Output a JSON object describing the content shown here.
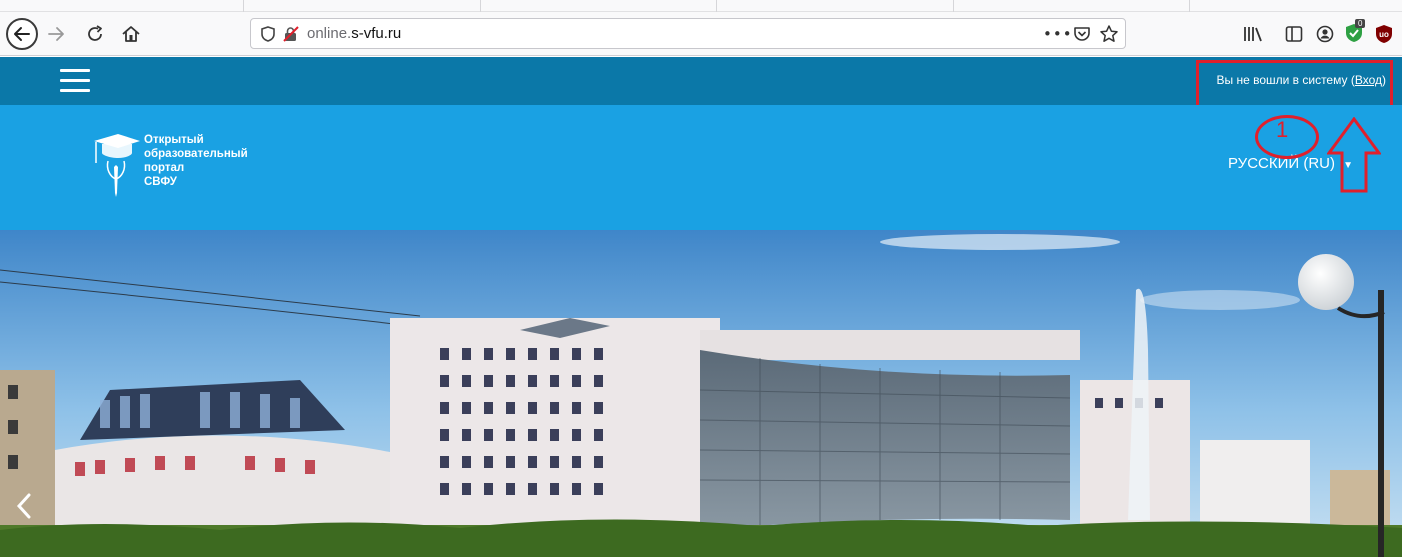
{
  "browser": {
    "url_prefix": "online.",
    "url_domain": "s-vfu.ru",
    "ext_badge": "0"
  },
  "site": {
    "login_text": "Вы не вошли в систему",
    "login_link": "Вход",
    "logo_lines": [
      "Открытый",
      "образовательный",
      "портал",
      "СВФУ"
    ],
    "language": "РУССКИЙ (RU)"
  },
  "annotation": {
    "number": "1"
  },
  "colors": {
    "topbar": "#0b78a8",
    "brand_band": "#1aa1e3",
    "annotation": "#e0202c"
  }
}
